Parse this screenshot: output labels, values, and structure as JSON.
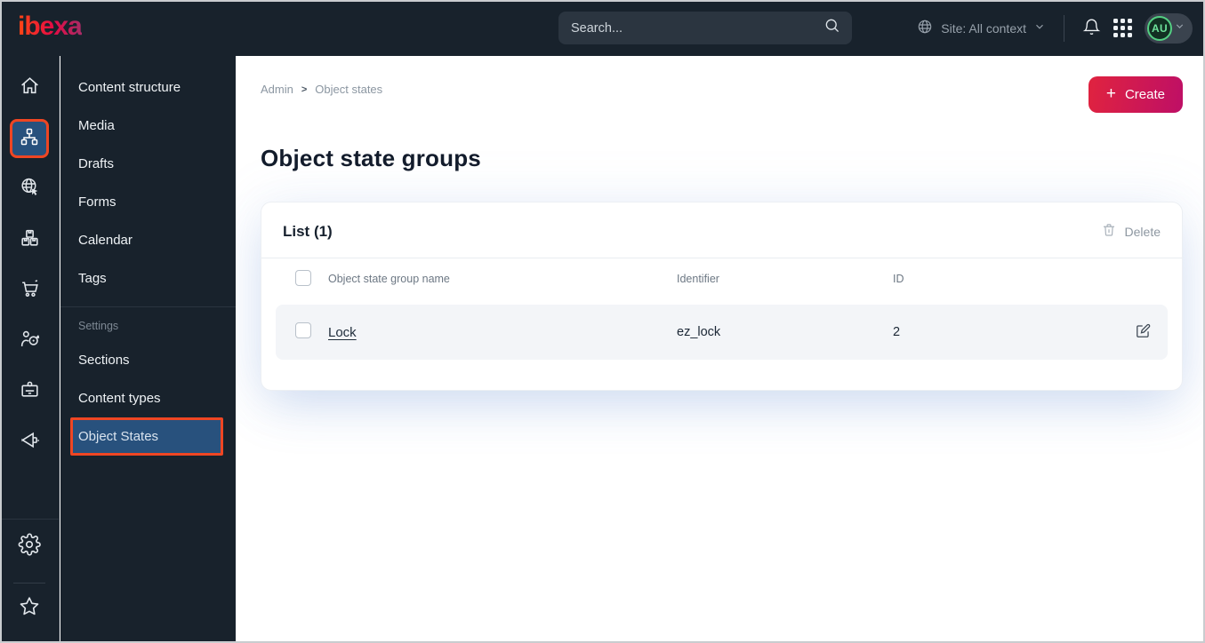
{
  "topbar": {
    "logo": "ibexa",
    "search_placeholder": "Search...",
    "site_context": "Site: All context",
    "avatar_initials": "AU"
  },
  "rail": {
    "items": [
      "home",
      "content-structure",
      "site",
      "products",
      "cart",
      "personalization",
      "corporate",
      "marketing"
    ],
    "active_item": "content-structure",
    "bottom_items": [
      "settings",
      "bookmarks"
    ]
  },
  "sidebar": {
    "items": [
      "Content structure",
      "Media",
      "Drafts",
      "Forms",
      "Calendar",
      "Tags"
    ],
    "settings_label": "Settings",
    "settings_items": [
      "Sections",
      "Content types",
      "Object States"
    ],
    "active_item": "Object States"
  },
  "breadcrumb": {
    "items": [
      "Admin",
      "Object states"
    ],
    "separator": ">"
  },
  "page": {
    "title": "Object state groups",
    "create_label": "Create",
    "create_plus": "+"
  },
  "list": {
    "title": "List (1)",
    "delete_label": "Delete",
    "columns": [
      "Object state group name",
      "Identifier",
      "ID"
    ],
    "rows": [
      {
        "name": "Lock",
        "identifier": "ez_lock",
        "id": "2"
      }
    ]
  },
  "colors": {
    "topbar_bg": "#18222c",
    "active_blue": "#28517d",
    "highlight_orange": "#ef4623",
    "create_gradient_start": "#e0233f",
    "create_gradient_end": "#be0f66",
    "avatar_green": "#54cf83",
    "row_bg": "#f3f5f8"
  }
}
